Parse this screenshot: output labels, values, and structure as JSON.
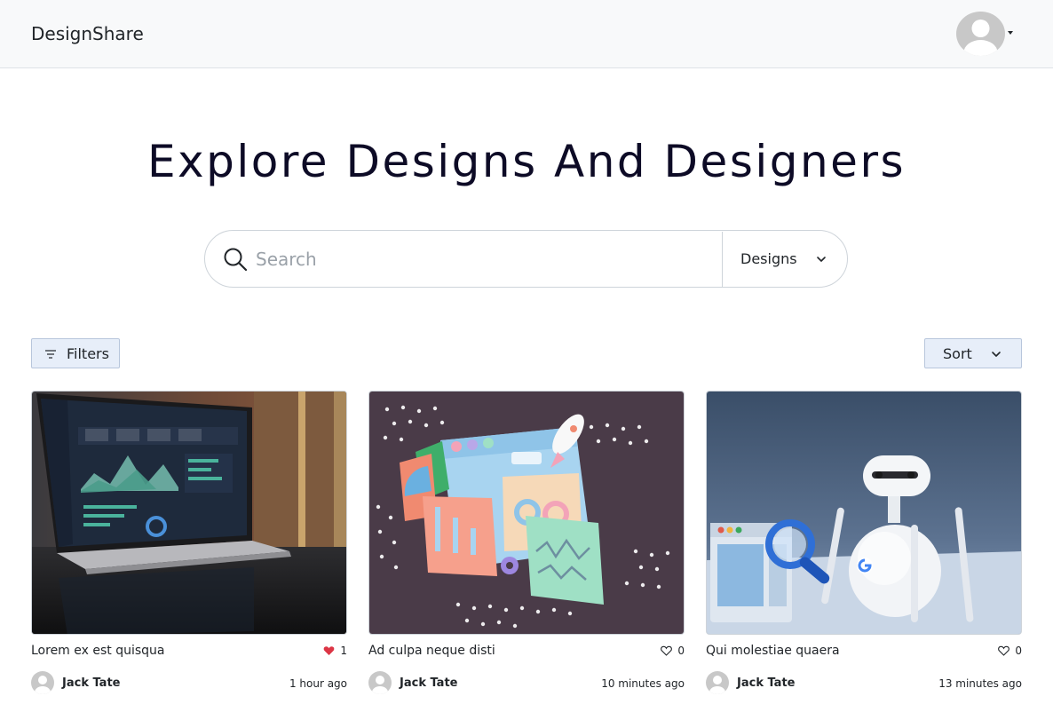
{
  "navbar": {
    "brand": "DesignShare"
  },
  "hero": {
    "title": "Explore Designs And Designers"
  },
  "search": {
    "placeholder": "Search",
    "value": "",
    "type_selected": "Designs"
  },
  "toolbar": {
    "filters_label": "Filters",
    "sort_label": "Sort"
  },
  "cards": [
    {
      "title": "Lorem ex est quisqua",
      "likes": "1",
      "liked": true,
      "author": "Jack Tate",
      "time": "1 hour ago",
      "thumbnail": "laptop-analytics-dashboard"
    },
    {
      "title": "Ad culpa neque disti",
      "likes": "0",
      "liked": false,
      "author": "Jack Tate",
      "time": "10 minutes ago",
      "thumbnail": "seo-3d-illustration"
    },
    {
      "title": "Qui molestiae quaera",
      "likes": "0",
      "liked": false,
      "author": "Jack Tate",
      "time": "13 minutes ago",
      "thumbnail": "google-robot-magnifier"
    }
  ],
  "colors": {
    "navbar_bg": "#f8f9fa",
    "title_text": "#0d0b26",
    "button_bg": "#e7eef9",
    "button_border": "#b8c6dc",
    "liked_heart": "#dc3545"
  }
}
